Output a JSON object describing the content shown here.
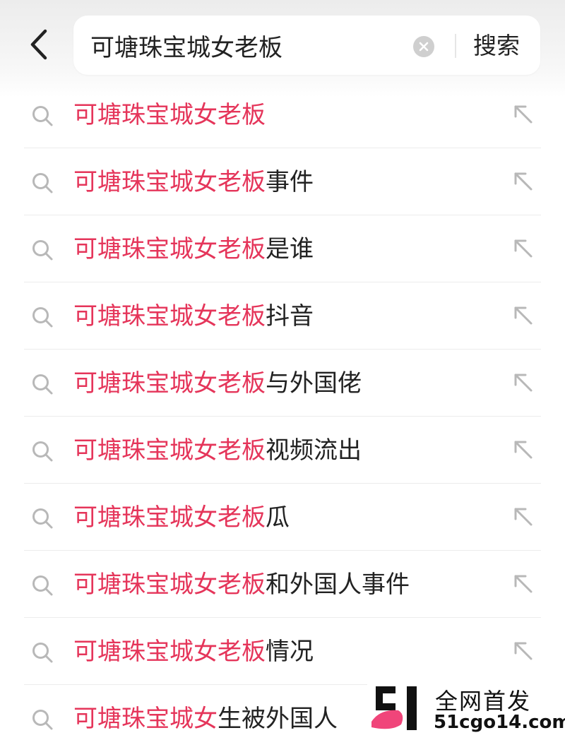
{
  "colors": {
    "highlight": "#e5355a",
    "text": "#222222",
    "icon": "#b8b8b8"
  },
  "header": {
    "back_icon": "chevron-left-icon",
    "search": {
      "value": "可塘珠宝城女老板",
      "clear_icon": "clear-circle-icon",
      "button_label": "搜索"
    }
  },
  "suggestions": [
    {
      "highlight": "可塘珠宝城女老板",
      "rest": ""
    },
    {
      "highlight": "可塘珠宝城女老板",
      "rest": "事件"
    },
    {
      "highlight": "可塘珠宝城女老板",
      "rest": "是谁"
    },
    {
      "highlight": "可塘珠宝城女老板",
      "rest": "抖音"
    },
    {
      "highlight": "可塘珠宝城女老板",
      "rest": "与外国佬"
    },
    {
      "highlight": "可塘珠宝城女老板",
      "rest": "视频流出"
    },
    {
      "highlight": "可塘珠宝城女老板",
      "rest": "瓜"
    },
    {
      "highlight": "可塘珠宝城女老板",
      "rest": "和外国人事件"
    },
    {
      "highlight": "可塘珠宝城女老板",
      "rest": "情况"
    },
    {
      "highlight": "可塘珠宝城女",
      "rest": "生被外国人"
    }
  ],
  "watermark": {
    "line1": "全网首发",
    "line2": "51cgo14.com"
  }
}
